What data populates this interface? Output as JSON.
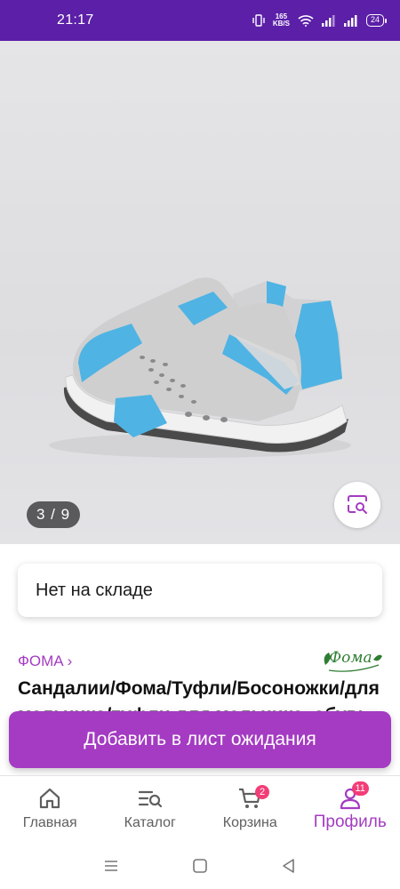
{
  "status_bar": {
    "time": "21:17",
    "net_speed_value": "165",
    "net_speed_unit": "KB/S",
    "battery": "24"
  },
  "gallery": {
    "counter": "3 / 9",
    "current_image": 3,
    "total_images": 9
  },
  "stock": {
    "label": "Нет на складе"
  },
  "product": {
    "brand": "ФОМА",
    "brand_arrow": "›",
    "brand_logo_text": "Фома",
    "title": "Сандалии/Фома/Туфли/Босоножки/для мальчико/туфли для мальчика, обувь"
  },
  "actions": {
    "waitlist_label": "Добавить в лист ожидания"
  },
  "bottom_nav": {
    "items": [
      {
        "label": "Главная",
        "icon": "home-icon"
      },
      {
        "label": "Каталог",
        "icon": "catalog-search-icon"
      },
      {
        "label": "Корзина",
        "icon": "cart-icon",
        "badge": "2"
      },
      {
        "label": "Профиль",
        "icon": "profile-icon",
        "badge": "11",
        "active": true
      }
    ]
  },
  "colors": {
    "status_bar": "#5b1fa8",
    "accent": "#a43bc2",
    "badge": "#f23d78",
    "shoe_leather": "#cfcfcf",
    "shoe_accent": "#55b7e6"
  }
}
